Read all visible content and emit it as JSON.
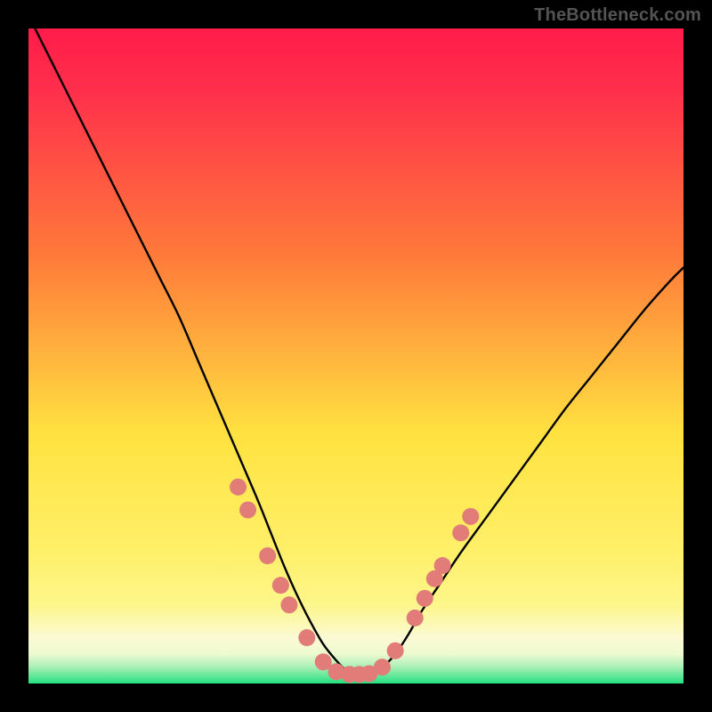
{
  "watermark": "TheBottleneck.com",
  "colors": {
    "frame": "#000000",
    "top_grad": "#ff1b4a",
    "mid_grad_upper": "#ff7b3a",
    "mid_grad": "#ffe240",
    "mid_grad_lower": "#fdf68a",
    "near_bottom_cream": "#fbfad4",
    "bottom_green": "#24e07f",
    "curve": "#000000",
    "marker_fill": "#e27c78",
    "marker_stroke": "#b46b65"
  },
  "chart_data": {
    "type": "line",
    "title": "",
    "xlabel": "",
    "ylabel": "",
    "xlim": [
      0,
      100
    ],
    "ylim": [
      0,
      100
    ],
    "series": [
      {
        "name": "bottleneck-curve",
        "x": [
          1,
          5,
          8,
          11,
          14,
          17,
          20,
          23,
          26,
          29,
          32,
          35,
          37,
          39,
          41,
          43,
          45,
          47,
          48.5,
          50,
          52,
          54,
          56,
          58,
          60,
          63,
          66,
          70,
          74,
          78,
          82,
          86,
          90,
          94,
          98,
          100
        ],
        "y": [
          100,
          92,
          86,
          80,
          74,
          68,
          62,
          56,
          49,
          42,
          35,
          28,
          23,
          18,
          13.5,
          9.5,
          6,
          3.5,
          2,
          1.4,
          1.5,
          2.5,
          4.5,
          7.5,
          11,
          15.5,
          20,
          25.5,
          31,
          36.5,
          42,
          47,
          52,
          57,
          61.5,
          63.5
        ]
      }
    ],
    "markers": {
      "name": "data-points",
      "points": [
        {
          "x": 32.0,
          "y": 30.0
        },
        {
          "x": 33.5,
          "y": 26.5
        },
        {
          "x": 36.5,
          "y": 19.5
        },
        {
          "x": 38.5,
          "y": 15.0
        },
        {
          "x": 39.8,
          "y": 12.0
        },
        {
          "x": 42.5,
          "y": 7.0
        },
        {
          "x": 45.0,
          "y": 3.3
        },
        {
          "x": 47.0,
          "y": 1.8
        },
        {
          "x": 49.0,
          "y": 1.4
        },
        {
          "x": 50.5,
          "y": 1.4
        },
        {
          "x": 52.0,
          "y": 1.5
        },
        {
          "x": 54.0,
          "y": 2.5
        },
        {
          "x": 56.0,
          "y": 5.0
        },
        {
          "x": 59.0,
          "y": 10.0
        },
        {
          "x": 60.5,
          "y": 13.0
        },
        {
          "x": 62.0,
          "y": 16.0
        },
        {
          "x": 63.2,
          "y": 18.0
        },
        {
          "x": 66.0,
          "y": 23.0
        },
        {
          "x": 67.5,
          "y": 25.5
        }
      ]
    },
    "gradient_bands": [
      {
        "y_from": 96,
        "y_to": 100,
        "note": "top red"
      },
      {
        "y_from": 20,
        "y_to": 96,
        "note": "red-orange-yellow smooth"
      },
      {
        "y_from": 8,
        "y_to": 20,
        "note": "pale yellow / cream"
      },
      {
        "y_from": 2,
        "y_to": 8,
        "note": "cream to pale green"
      },
      {
        "y_from": 0,
        "y_to": 2,
        "note": "green strip"
      }
    ]
  }
}
